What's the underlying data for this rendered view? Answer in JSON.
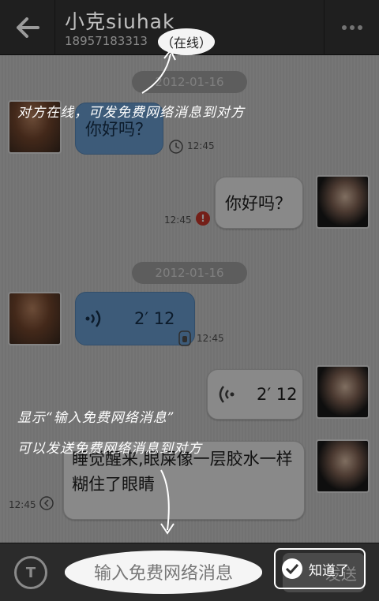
{
  "header": {
    "contact_name": "小克siuhak",
    "phone": "18957183313",
    "status": "（在线）"
  },
  "messages": {
    "date_1": "2012-01-16",
    "date_2": "2012-01-16",
    "msg_1_text": "你好吗？",
    "msg_1_time": "12:45",
    "msg_2_text": "你好吗？",
    "msg_2_time": "12:45",
    "msg_3_duration": "2′ 12",
    "msg_3_time": "12:45",
    "msg_4_duration": "2′ 12",
    "msg_5_text": "睡觉醒来,眼屎像一层胶水一样糊住了眼睛",
    "msg_5_time": "12:45"
  },
  "input_bar": {
    "mode_label": "T",
    "placeholder": "输入免费网络消息",
    "send_label": "发送"
  },
  "guide": {
    "hint_top": "对方在线，可发免费网络消息到对方",
    "hint_bottom_1": "显示“输入免费网络消息”",
    "hint_bottom_2": "可以发送免费网络消息到对方",
    "got_it_label": "知道了"
  },
  "colors": {
    "header_bg": "#2a2a2a",
    "incoming_bubble": "#6fa6dc",
    "outgoing_bubble": "#fafafa",
    "error_red": "#d33a2c"
  }
}
